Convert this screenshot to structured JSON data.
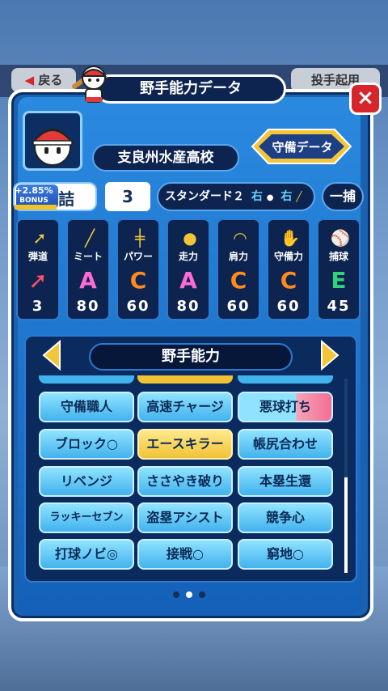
{
  "background": {
    "back_label": "戻る",
    "pitcher_label": "投手起用"
  },
  "dialog": {
    "title": "野手能力データ",
    "close_label": "×"
  },
  "profile": {
    "school": "支良州水産高校",
    "defense_button": "守備データ"
  },
  "bonus": {
    "percent": "+2.85%",
    "word": "BONUS",
    "stat_label": "詰",
    "number": "3"
  },
  "batting": {
    "style_text": "スタンダード２",
    "throw_hand": "右",
    "bat_hand": "右",
    "position": "一捕"
  },
  "stats": [
    {
      "label": "弾道",
      "grade": "",
      "value": "3",
      "icon": "trajectory-icon",
      "color": "#ff4d6d"
    },
    {
      "label": "ミート",
      "grade": "A",
      "value": "80",
      "icon": "bat-icon",
      "color": "#ff6ad5"
    },
    {
      "label": "パワー",
      "grade": "C",
      "value": "60",
      "icon": "barbell-icon",
      "color": "#ff8a1e"
    },
    {
      "label": "走力",
      "grade": "A",
      "value": "80",
      "icon": "runner-icon",
      "color": "#ff6ad5"
    },
    {
      "label": "肩力",
      "grade": "C",
      "value": "60",
      "icon": "throw-arc-icon",
      "color": "#ff8a1e"
    },
    {
      "label": "守備力",
      "grade": "C",
      "value": "60",
      "icon": "glove-icon",
      "color": "#ff8a1e"
    },
    {
      "label": "捕球",
      "grade": "E",
      "value": "45",
      "icon": "catch-ball-icon",
      "color": "#33d17a"
    }
  ],
  "abilities_panel": {
    "title": "野手能力"
  },
  "abilities": [
    {
      "name": "守備職人",
      "style": ""
    },
    {
      "name": "高速チャージ",
      "style": ""
    },
    {
      "name": "悪球打ち",
      "style": "pink"
    },
    {
      "name": "ブロック○",
      "style": ""
    },
    {
      "name": "エースキラー",
      "style": "gold"
    },
    {
      "name": "帳尻合わせ",
      "style": ""
    },
    {
      "name": "リベンジ",
      "style": ""
    },
    {
      "name": "ささやき破り",
      "style": ""
    },
    {
      "name": "本塁生還",
      "style": ""
    },
    {
      "name": "ラッキーセブン",
      "style": "small"
    },
    {
      "name": "盗塁アシスト",
      "style": ""
    },
    {
      "name": "競争心",
      "style": ""
    },
    {
      "name": "打球ノビ◎",
      "style": ""
    },
    {
      "name": "接戦○",
      "style": ""
    },
    {
      "name": "窮地○",
      "style": ""
    }
  ],
  "pagination": {
    "count": 3,
    "active": 1
  }
}
